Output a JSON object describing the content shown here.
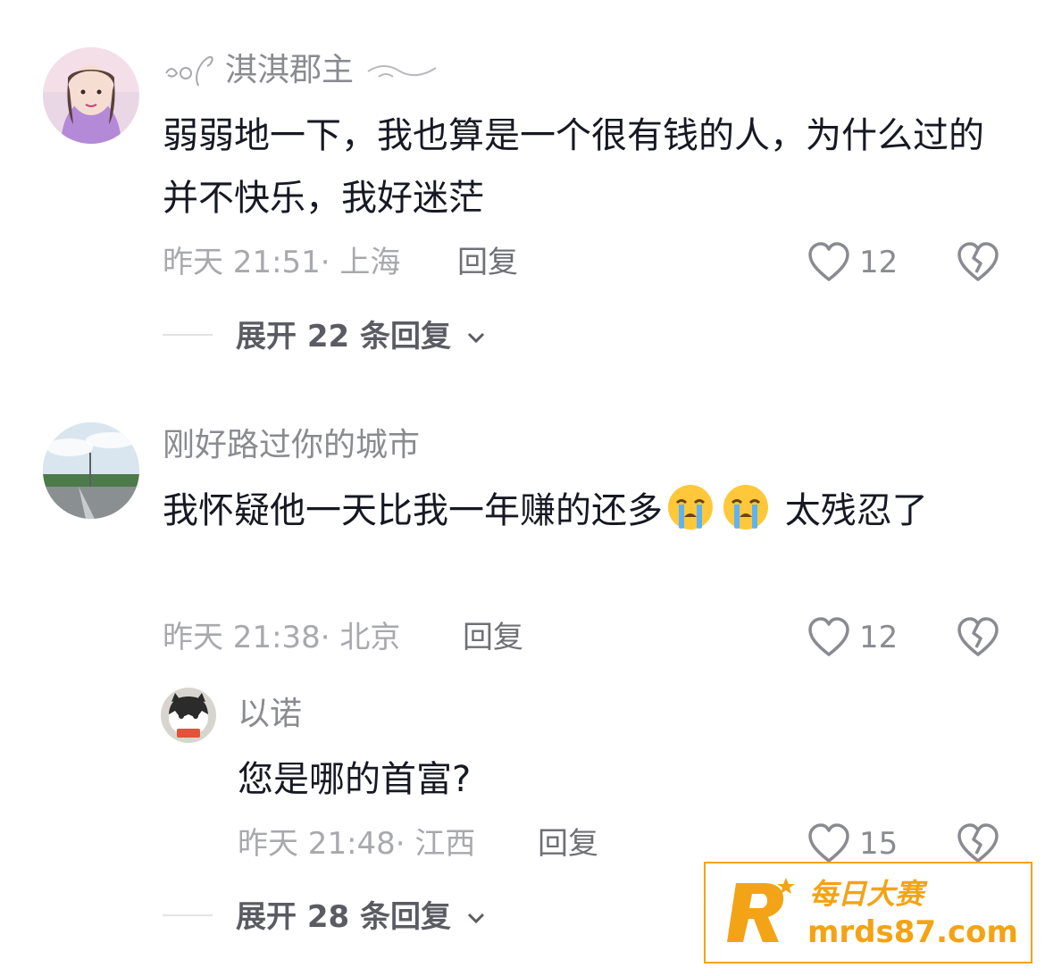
{
  "comments": [
    {
      "username": "淇淇郡主",
      "text": "弱弱地一下，我也算是一个很有钱的人，为什么过的并不快乐，我好迷茫",
      "time_location": "昨天 21:51· 上海",
      "reply_label": "回复",
      "likes": "12",
      "expand_label": "展开 22 条回复"
    },
    {
      "username": "刚好路过你的城市",
      "text_main": "我怀疑他一天比我一年赚的还多",
      "text_tail": " 太残忍了",
      "time_location": "昨天 21:38· 北京",
      "reply_label": "回复",
      "likes": "12",
      "emojis": [
        "crying-face",
        "crying-face"
      ]
    }
  ],
  "reply": {
    "username": "以诺",
    "text": "您是哪的首富?",
    "time_location": "昨天 21:48· 江西",
    "reply_label": "回复",
    "likes": "15",
    "expand_label": "展开 28 条回复"
  },
  "watermark": {
    "brand": "每日大赛",
    "site": "mrds87.com",
    "color": "#f3a316"
  }
}
